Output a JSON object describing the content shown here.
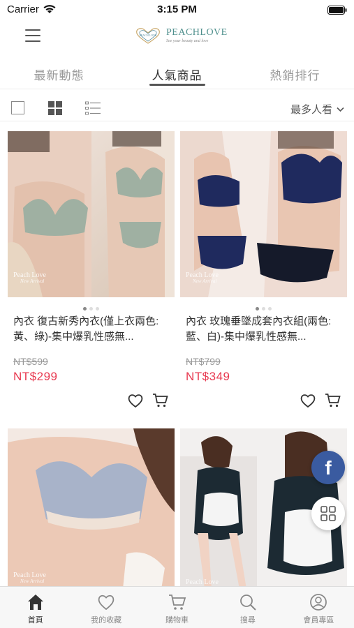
{
  "status": {
    "carrier": "Carrier",
    "time": "3:15 PM"
  },
  "header": {
    "logo_name": "PEACHLOVE",
    "logo_slogan": "See your beauty and love",
    "logo_mark_text": "PEACH LOVE"
  },
  "tabs": [
    {
      "label": "最新動態",
      "active": false
    },
    {
      "label": "人氣商品",
      "active": true
    },
    {
      "label": "熱銷排行",
      "active": false
    }
  ],
  "toolbar": {
    "sort_label": "最多人看"
  },
  "products": [
    {
      "title": "內衣 復古新秀內衣(僅上衣兩色:黃、綠)-集中爆乳性感無...",
      "price_old": "NT$599",
      "price_new": "NT$299",
      "watermark": "Peach Love",
      "watermark_sub": "New Arrival",
      "colors": [
        "#9fb0a2",
        "#f3ece7"
      ]
    },
    {
      "title": "內衣 玫瑰垂墜成套內衣組(兩色:藍、白)-集中爆乳性感無...",
      "price_old": "NT$799",
      "price_new": "NT$349",
      "watermark": "Peach Love",
      "watermark_sub": "New Arrival",
      "colors": [
        "#1f2a5e",
        "#f2e4de"
      ]
    },
    {
      "watermark": "Peach Love",
      "watermark_sub": "New Arrival",
      "colors": [
        "#a8b3c9",
        "#efe2d7"
      ]
    },
    {
      "watermark": "Peach Love",
      "colors": [
        "#1c2a33",
        "#f4f4f4"
      ]
    }
  ],
  "fab": {
    "facebook_label": "f"
  },
  "bottom_nav": [
    {
      "label": "首頁",
      "icon": "home-icon",
      "active": true
    },
    {
      "label": "我的收藏",
      "icon": "heart-icon",
      "active": false
    },
    {
      "label": "購物車",
      "icon": "cart-icon",
      "active": false
    },
    {
      "label": "搜尋",
      "icon": "search-icon",
      "active": false
    },
    {
      "label": "會員專區",
      "icon": "user-icon",
      "active": false
    }
  ]
}
